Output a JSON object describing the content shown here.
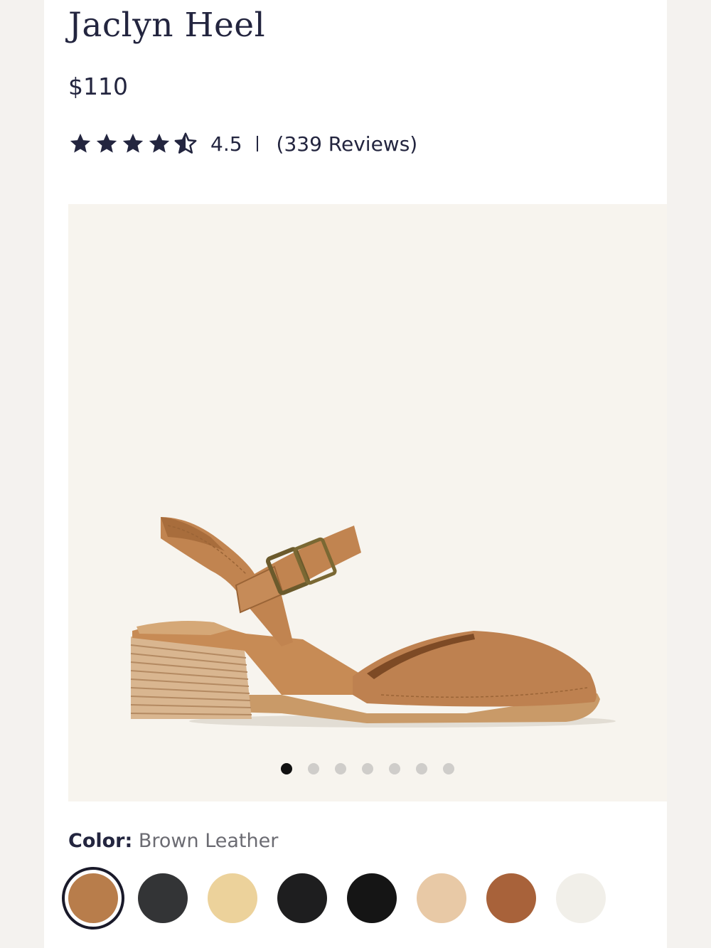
{
  "product": {
    "title": "Jaclyn Heel",
    "price": "$110",
    "rating": {
      "stars_filled": 4.5,
      "stars_max": 5,
      "value": "4.5",
      "reviews": "(339 Reviews)"
    }
  },
  "gallery": {
    "image": "brown-leather-slingback-block-heel",
    "slide_count": 7,
    "active_slide": 1
  },
  "color": {
    "label": "Color:",
    "selected": "Brown Leather",
    "swatches": [
      {
        "name": "brown-leather",
        "color": "#b87d4b",
        "selected": true
      },
      {
        "name": "black-leather",
        "color": "#333436"
      },
      {
        "name": "cream",
        "color": "#ecd29b"
      },
      {
        "name": "black-woven",
        "color": "#1e1e1f"
      },
      {
        "name": "black-perforated",
        "color": "#151515"
      },
      {
        "name": "natural-raffia",
        "color": "#e8c9a6"
      },
      {
        "name": "brown-spotted",
        "color": "#a8623a"
      },
      {
        "name": "white-spotted",
        "color": "#f1efe9"
      }
    ]
  },
  "colors": {
    "text": "#23253f",
    "gallery_bg": "#f7f4ee",
    "dot_active": "#111111",
    "dot_inactive": "#cfcdca"
  }
}
